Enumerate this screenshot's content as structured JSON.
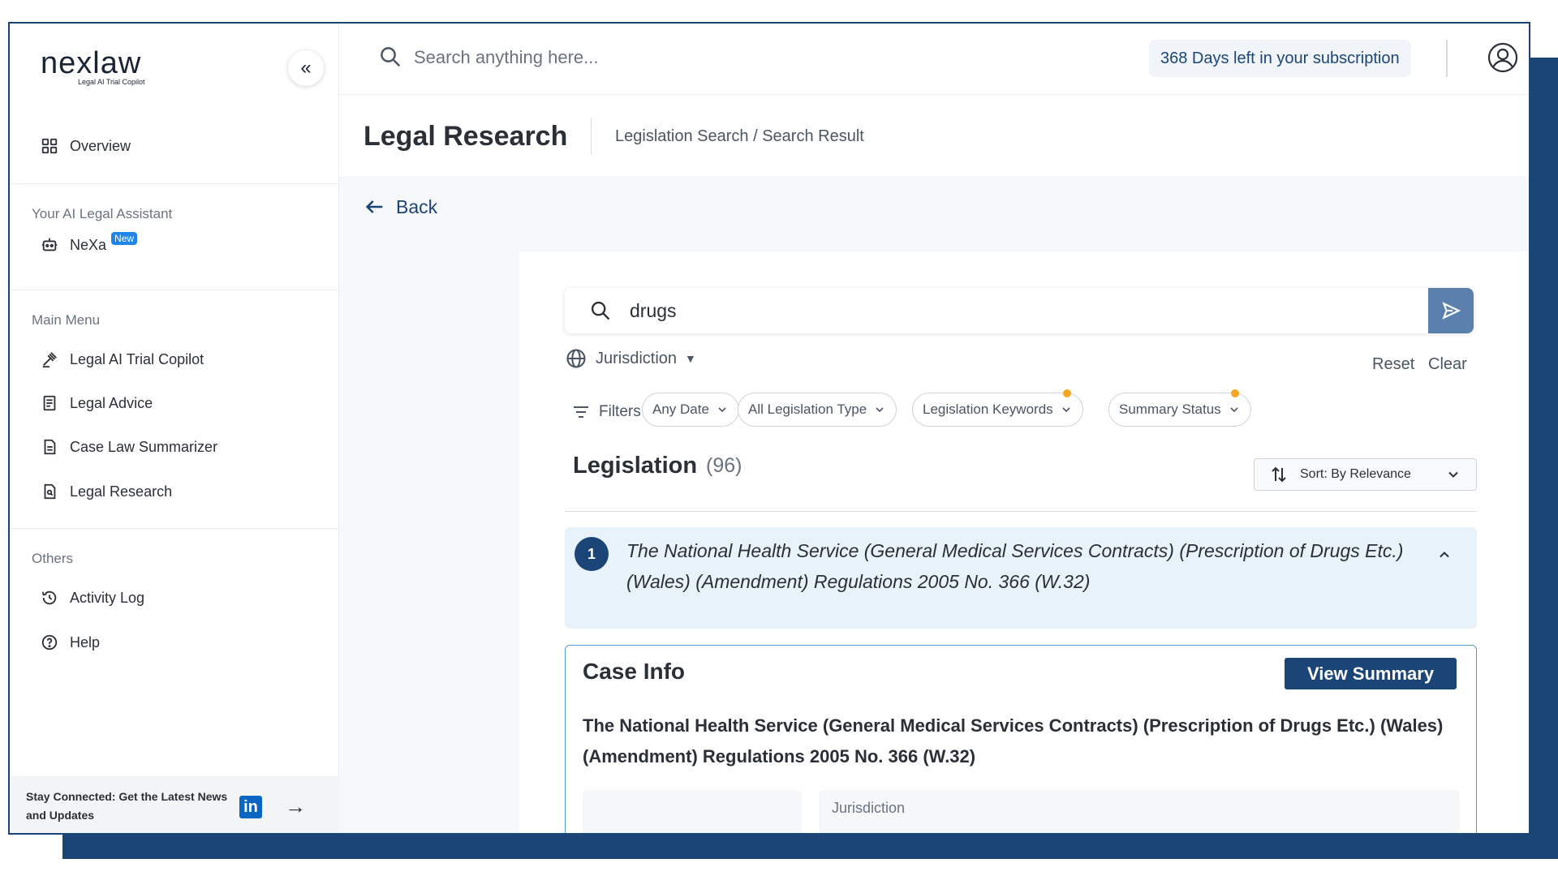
{
  "brand": {
    "name": "nexlaw",
    "tagline": "Legal AI Trial Copilot"
  },
  "sidebar": {
    "overview_label": "Overview",
    "assistant_section": "Your AI Legal Assistant",
    "nexa_label": "NeXa",
    "nexa_badge": "New",
    "main_menu_section": "Main Menu",
    "main_menu": [
      {
        "label": "Legal AI Trial Copilot",
        "icon": "gavel-icon"
      },
      {
        "label": "Legal Advice",
        "icon": "document-list-icon"
      },
      {
        "label": "Case Law Summarizer",
        "icon": "document-icon"
      },
      {
        "label": "Legal Research",
        "icon": "document-search-icon"
      }
    ],
    "others_section": "Others",
    "others": [
      {
        "label": "Activity Log",
        "icon": "history-icon"
      },
      {
        "label": "Help",
        "icon": "help-icon"
      }
    ],
    "stay_connected": "Stay Connected: Get the Latest News and Updates",
    "linkedin_text": "in"
  },
  "topbar": {
    "search_placeholder": "Search anything here...",
    "subscription": "368 Days left in your subscription"
  },
  "header": {
    "title": "Legal Research",
    "breadcrumb": "Legislation Search / Search Result"
  },
  "content": {
    "back_label": "Back",
    "query": "drugs",
    "jurisdiction_label": "Jurisdiction",
    "reset_label": "Reset",
    "clear_label": "Clear",
    "filters_label": "Filters :",
    "filters": [
      {
        "label": "Any Date",
        "dot": false
      },
      {
        "label": "All Legislation Type",
        "dot": false
      },
      {
        "label": "Legislation Keywords",
        "dot": true
      },
      {
        "label": "Summary Status",
        "dot": true
      }
    ],
    "results_title": "Legislation",
    "results_count": "(96)",
    "sort_label": "Sort: By Relevance",
    "result_item": {
      "number": "1",
      "title": "The National Health Service (General Medical Services Contracts) (Prescription of Drugs Etc.) (Wales) (Amendment) Regulations 2005 No. 366 (W.32)"
    },
    "case_info": {
      "title": "Case Info",
      "view_summary_label": "View Summary",
      "text": "The National Health Service (General Medical Services Contracts) (Prescription of Drugs Etc.) (Wales) (Amendment) Regulations 2005 No. 366 (W.32)",
      "jurisdiction_label": "Jurisdiction"
    }
  },
  "colors": {
    "navy": "#1c4577",
    "send": "#5b80ad",
    "accent_dot": "#f5a623",
    "item_bg": "#e8f2fb"
  }
}
